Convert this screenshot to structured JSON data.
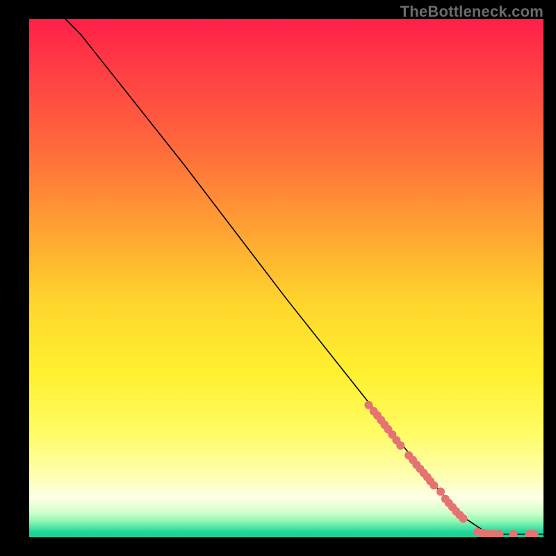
{
  "watermark": "TheBottleneck.com",
  "chart_data": {
    "type": "line",
    "title": "",
    "xlabel": "",
    "ylabel": "",
    "xlim": [
      0,
      100
    ],
    "ylim": [
      0,
      100
    ],
    "grid": false,
    "legend": false,
    "background_gradient": [
      {
        "stop": 0,
        "color": "#ff1f48"
      },
      {
        "stop": 0.55,
        "color": "#ffd62d"
      },
      {
        "stop": 0.92,
        "color": "#feffe7"
      },
      {
        "stop": 1.0,
        "color": "#18cf95"
      }
    ],
    "series": [
      {
        "name": "curve",
        "style": {
          "stroke": "#000000",
          "stroke_width": 1.5
        },
        "points": [
          {
            "x": 7,
            "y": 100
          },
          {
            "x": 10,
            "y": 97
          },
          {
            "x": 14,
            "y": 92
          },
          {
            "x": 20,
            "y": 84.5
          },
          {
            "x": 30,
            "y": 72
          },
          {
            "x": 40,
            "y": 59
          },
          {
            "x": 50,
            "y": 46
          },
          {
            "x": 60,
            "y": 33.5
          },
          {
            "x": 66,
            "y": 26
          },
          {
            "x": 72,
            "y": 18.5
          },
          {
            "x": 78,
            "y": 11
          },
          {
            "x": 82,
            "y": 6.5
          },
          {
            "x": 85,
            "y": 3.5
          },
          {
            "x": 88,
            "y": 1.5
          },
          {
            "x": 92,
            "y": 0.6
          },
          {
            "x": 100,
            "y": 0.6
          }
        ]
      },
      {
        "name": "scatter-dots",
        "style": {
          "fill": "#e57373",
          "radius": 6
        },
        "points": [
          {
            "x": 66,
            "y": 25.5
          },
          {
            "x": 67,
            "y": 24.3
          },
          {
            "x": 67.7,
            "y": 23.5
          },
          {
            "x": 68.4,
            "y": 22.6
          },
          {
            "x": 69.1,
            "y": 21.7
          },
          {
            "x": 69.8,
            "y": 20.8
          },
          {
            "x": 70.6,
            "y": 19.8
          },
          {
            "x": 71.4,
            "y": 18.7
          },
          {
            "x": 72.2,
            "y": 17.7
          },
          {
            "x": 73.8,
            "y": 15.8
          },
          {
            "x": 74.6,
            "y": 14.9
          },
          {
            "x": 75.3,
            "y": 14.0
          },
          {
            "x": 76.0,
            "y": 13.2
          },
          {
            "x": 76.7,
            "y": 12.4
          },
          {
            "x": 77.4,
            "y": 11.6
          },
          {
            "x": 78.0,
            "y": 10.8
          },
          {
            "x": 78.7,
            "y": 10.0
          },
          {
            "x": 80.0,
            "y": 8.8
          },
          {
            "x": 80.9,
            "y": 7.4
          },
          {
            "x": 81.6,
            "y": 6.6
          },
          {
            "x": 82.3,
            "y": 5.8
          },
          {
            "x": 83.0,
            "y": 5.0
          },
          {
            "x": 83.7,
            "y": 4.3
          },
          {
            "x": 84.4,
            "y": 3.6
          },
          {
            "x": 87.2,
            "y": 1.0
          },
          {
            "x": 88.0,
            "y": 0.8
          },
          {
            "x": 88.8,
            "y": 0.7
          },
          {
            "x": 89.6,
            "y": 0.65
          },
          {
            "x": 90.4,
            "y": 0.62
          },
          {
            "x": 91.4,
            "y": 0.6
          },
          {
            "x": 94.1,
            "y": 0.6
          },
          {
            "x": 97.2,
            "y": 0.6
          },
          {
            "x": 98.2,
            "y": 0.6
          }
        ]
      }
    ]
  }
}
